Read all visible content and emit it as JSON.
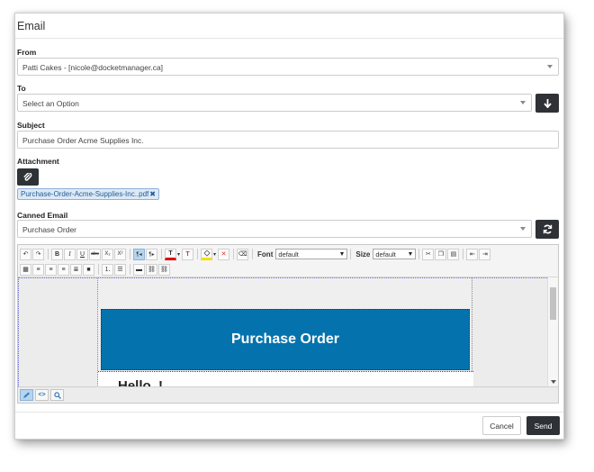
{
  "dialog": {
    "title": "Email"
  },
  "from": {
    "label": "From",
    "value": "Patti Cakes - [nicole@docketmanager.ca]"
  },
  "to": {
    "label": "To",
    "placeholder": "Select an Option",
    "action_icon": "arrow-down-icon"
  },
  "subject": {
    "label": "Subject",
    "value": "Purchase Order Acme Supplies Inc."
  },
  "attachment": {
    "label": "Attachment",
    "button_icon": "paperclip-icon",
    "file_name": "Purchase-Order-Acme-Supplies-Inc..pdf",
    "remove_glyph": "✖"
  },
  "canned_email": {
    "label": "Canned Email",
    "value": "Purchase Order",
    "action_icon": "refresh-icon"
  },
  "toolbar": {
    "bold": "B",
    "italic": "I",
    "underline": "U",
    "strike": "abc",
    "subscript": "X₂",
    "superscript": "X²",
    "ltr": "¶◂",
    "rtl": "¶▸",
    "font_color": "T",
    "clear_format": "T",
    "font_label": "Font",
    "font_value": "default",
    "size_label": "Size",
    "size_value": "default"
  },
  "content": {
    "banner_title": "Purchase Order",
    "greeting": "Hello ,!"
  },
  "footer": {
    "cancel_label": "Cancel",
    "send_label": "Send"
  },
  "colors": {
    "primary_dark": "#2e3236",
    "banner_blue": "#0473ad",
    "chip_bg": "#dde9f5"
  }
}
